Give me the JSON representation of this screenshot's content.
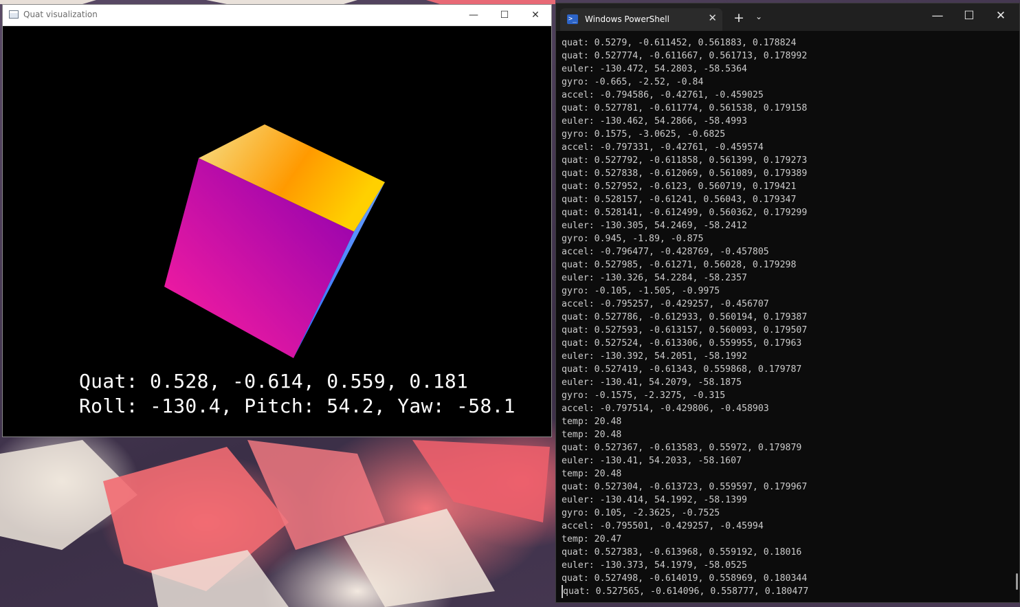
{
  "quat_window": {
    "title": "Quat visualization",
    "hud_line1": "Quat: 0.528, -0.614, 0.559, 0.181",
    "hud_line2": "Roll: -130.4, Pitch: 54.2, Yaw: -58.1"
  },
  "terminal": {
    "tab_title": "Windows PowerShell",
    "lines": [
      "quat: 0.5279, -0.611452, 0.561883, 0.178824",
      "quat: 0.527774, -0.611667, 0.561713, 0.178992",
      "euler: -130.472, 54.2803, -58.5364",
      "gyro: -0.665, -2.52, -0.84",
      "accel: -0.794586, -0.42761, -0.459025",
      "quat: 0.527781, -0.611774, 0.561538, 0.179158",
      "euler: -130.462, 54.2866, -58.4993",
      "gyro: 0.1575, -3.0625, -0.6825",
      "accel: -0.797331, -0.42761, -0.459574",
      "quat: 0.527792, -0.611858, 0.561399, 0.179273",
      "quat: 0.527838, -0.612069, 0.561089, 0.179389",
      "quat: 0.527952, -0.6123, 0.560719, 0.179421",
      "quat: 0.528157, -0.61241, 0.56043, 0.179347",
      "quat: 0.528141, -0.612499, 0.560362, 0.179299",
      "euler: -130.305, 54.2469, -58.2412",
      "gyro: 0.945, -1.89, -0.875",
      "accel: -0.796477, -0.428769, -0.457805",
      "quat: 0.527985, -0.61271, 0.56028, 0.179298",
      "euler: -130.326, 54.2284, -58.2357",
      "gyro: -0.105, -1.505, -0.9975",
      "accel: -0.795257, -0.429257, -0.456707",
      "quat: 0.527786, -0.612933, 0.560194, 0.179387",
      "quat: 0.527593, -0.613157, 0.560093, 0.179507",
      "quat: 0.527524, -0.613306, 0.559955, 0.17963",
      "euler: -130.392, 54.2051, -58.1992",
      "quat: 0.527419, -0.61343, 0.559868, 0.179787",
      "euler: -130.41, 54.2079, -58.1875",
      "gyro: -0.1575, -2.3275, -0.315",
      "accel: -0.797514, -0.429806, -0.458903",
      "temp: 20.48",
      "temp: 20.48",
      "quat: 0.527367, -0.613583, 0.55972, 0.179879",
      "euler: -130.41, 54.2033, -58.1607",
      "temp: 20.48",
      "quat: 0.527304, -0.613723, 0.559597, 0.179967",
      "euler: -130.414, 54.1992, -58.1399",
      "gyro: 0.105, -2.3625, -0.7525",
      "accel: -0.795501, -0.429257, -0.45994",
      "temp: 20.47",
      "quat: 0.527383, -0.613968, 0.559192, 0.18016",
      "euler: -130.373, 54.1979, -58.0525",
      "quat: 0.527498, -0.614019, 0.558969, 0.180344",
      "quat: 0.527565, -0.614096, 0.558777, 0.180477"
    ]
  },
  "colors": {
    "cube_top_a": "#f5e08a",
    "cube_top_b": "#ff9a00",
    "cube_front_a": "#ff1f9e",
    "cube_front_b": "#8a00b0",
    "cube_side": "#2f6cff"
  }
}
